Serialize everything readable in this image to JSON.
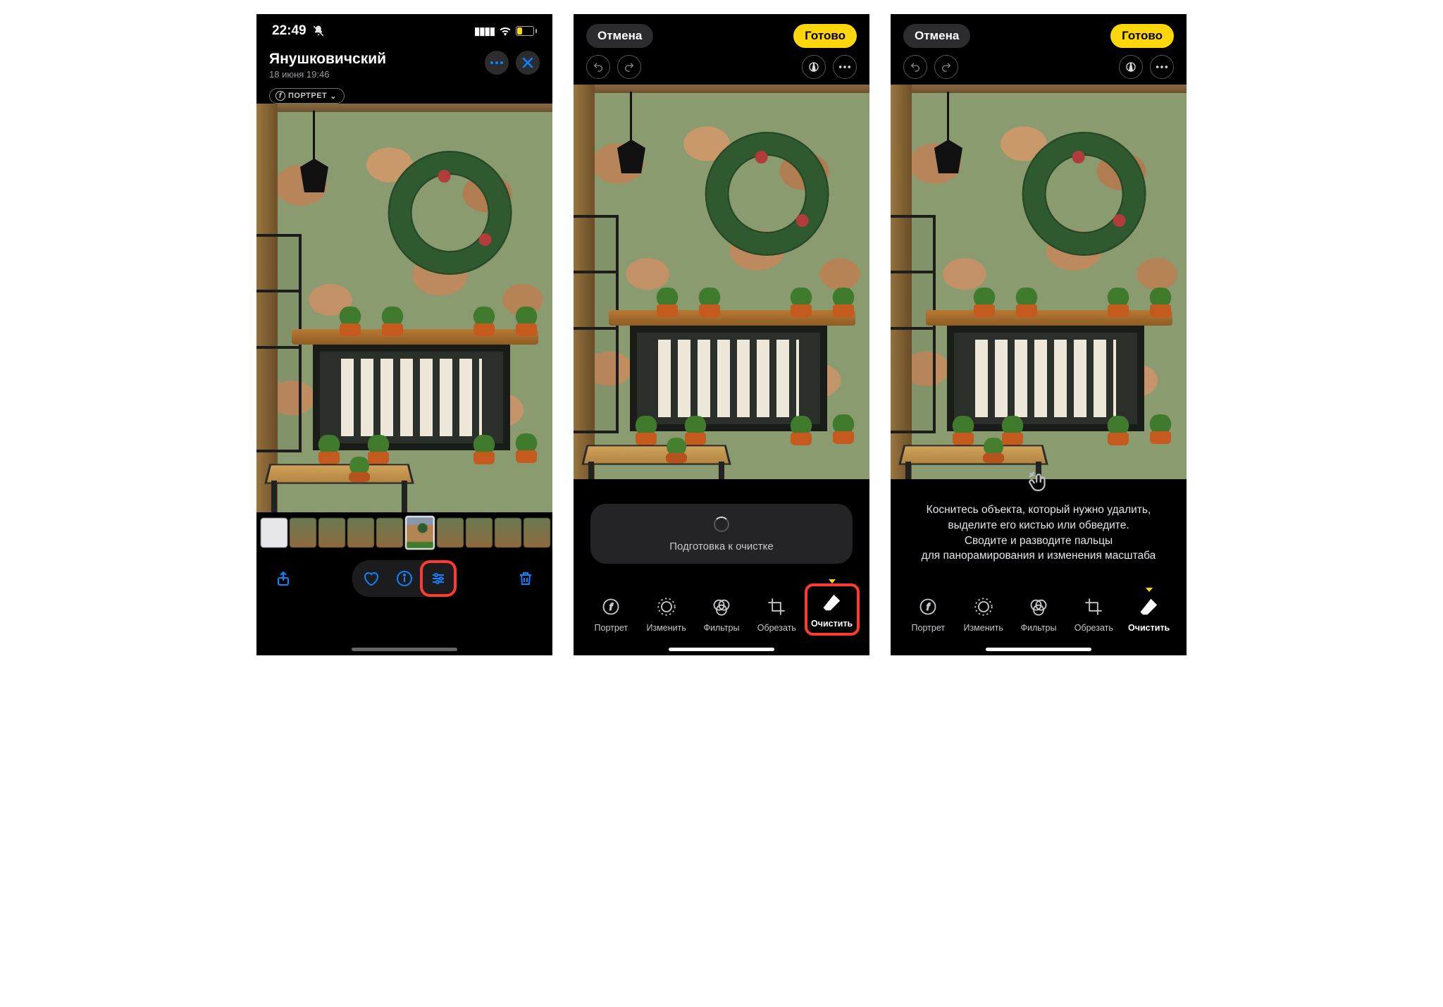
{
  "screen1": {
    "status": {
      "time": "22:49",
      "battery_level": "7"
    },
    "header": {
      "title": "Янушковичский",
      "subtitle": "18 июня  19:46"
    },
    "portrait_badge": "ПОРТРЕТ",
    "bottom_icons": {
      "share": "share-icon",
      "favorite": "heart-icon",
      "info": "info-icon",
      "edit": "sliders-icon",
      "delete": "trash-icon"
    }
  },
  "edit_common": {
    "cancel": "Отмена",
    "done": "Готово",
    "tools": [
      {
        "id": "portrait",
        "label": "Портрет"
      },
      {
        "id": "adjust",
        "label": "Изменить"
      },
      {
        "id": "filters",
        "label": "Фильтры"
      },
      {
        "id": "crop",
        "label": "Обрезать"
      },
      {
        "id": "cleanup",
        "label": "Очистить"
      }
    ]
  },
  "screen2": {
    "loading_text": "Подготовка к очистке"
  },
  "screen3": {
    "instruction_lines": [
      "Коснитесь объекта, который нужно удалить,",
      "выделите его кистью или обведите.",
      "Сводите и разводите пальцы",
      "для панорамирования и изменения масштаба"
    ]
  }
}
